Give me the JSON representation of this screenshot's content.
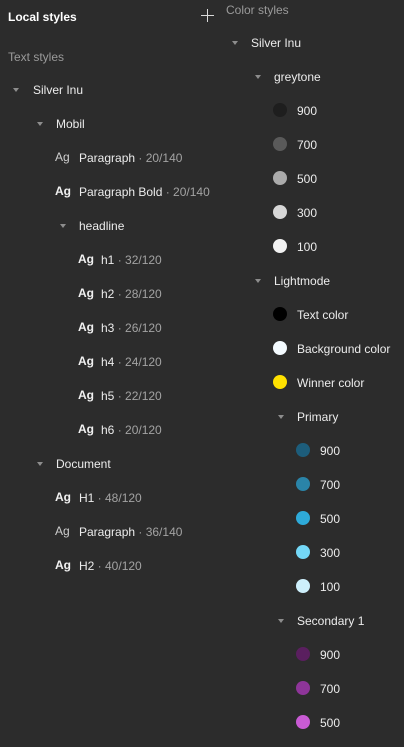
{
  "header": {
    "title": "Local styles",
    "add_icon": "plus-icon"
  },
  "text_styles": {
    "section_label": "Text styles",
    "group": "Silver Inu",
    "mobil": {
      "label": "Mobil",
      "ag": "Ag",
      "items": [
        {
          "name": "Paragraph",
          "meta": " · 20/140"
        },
        {
          "name": "Paragraph Bold",
          "meta": " · 20/140"
        }
      ],
      "headline": {
        "label": "headline",
        "items": [
          {
            "name": "h1",
            "meta": " · 32/120"
          },
          {
            "name": "h2",
            "meta": " · 28/120"
          },
          {
            "name": "h3",
            "meta": " · 26/120"
          },
          {
            "name": "h4",
            "meta": " · 24/120"
          },
          {
            "name": "h5",
            "meta": " · 22/120"
          },
          {
            "name": "h6",
            "meta": " · 20/120"
          }
        ]
      }
    },
    "document": {
      "label": "Document",
      "items": [
        {
          "name": "H1",
          "meta": " · 48/120"
        },
        {
          "name": "Paragraph",
          "meta": " · 36/140"
        },
        {
          "name": "H2",
          "meta": " · 40/120"
        }
      ]
    }
  },
  "color_styles": {
    "section_label": "Color styles",
    "group": "Silver Inu",
    "greytone": {
      "label": "greytone",
      "items": [
        {
          "name": "900",
          "color": "#1e1e1e"
        },
        {
          "name": "700",
          "color": "#5a5a5a"
        },
        {
          "name": "500",
          "color": "#ababab"
        },
        {
          "name": "300",
          "color": "#d7d7d7"
        },
        {
          "name": "100",
          "color": "#f2f2f2"
        }
      ]
    },
    "lightmode": {
      "label": "Lightmode",
      "items": [
        {
          "name": "Text color",
          "color": "#000000"
        },
        {
          "name": "Background color",
          "color": "#f4fbff"
        },
        {
          "name": "Winner color",
          "color": "#ffe100"
        }
      ],
      "primary": {
        "label": "Primary",
        "items": [
          {
            "name": "900",
            "color": "#1d5d7b"
          },
          {
            "name": "700",
            "color": "#2a84a8"
          },
          {
            "name": "500",
            "color": "#2eaad9"
          },
          {
            "name": "300",
            "color": "#74d8f7"
          },
          {
            "name": "100",
            "color": "#cdeffb"
          }
        ]
      },
      "secondary": {
        "label": "Secondary 1",
        "items": [
          {
            "name": "900",
            "color": "#5a1f5f"
          },
          {
            "name": "700",
            "color": "#8e3599"
          },
          {
            "name": "500",
            "color": "#c95bd4"
          }
        ]
      }
    }
  }
}
